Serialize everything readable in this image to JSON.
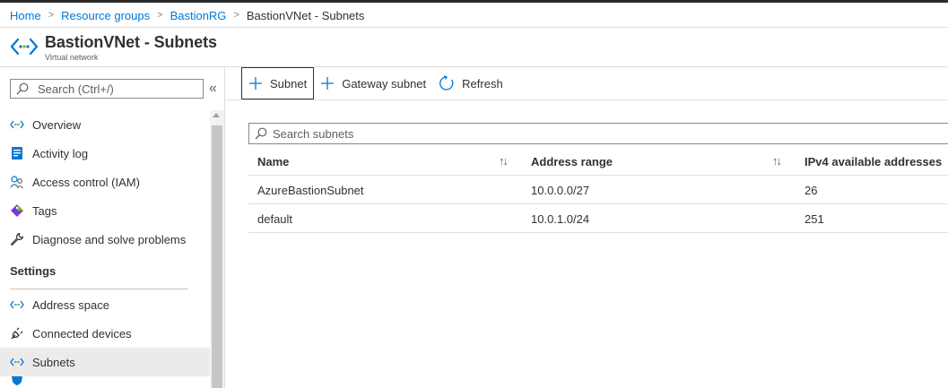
{
  "breadcrumb": {
    "items": [
      "Home",
      "Resource groups",
      "BastionRG"
    ],
    "current": "BastionVNet - Subnets"
  },
  "header": {
    "title": "BastionVNet - Subnets",
    "subtitle": "Virtual network"
  },
  "sidebar": {
    "search_placeholder": "Search (Ctrl+/)",
    "collapse_glyph": "«",
    "items": [
      {
        "label": "Overview",
        "icon": "vnet-icon"
      },
      {
        "label": "Activity log",
        "icon": "activity-log-icon"
      },
      {
        "label": "Access control (IAM)",
        "icon": "people-icon"
      },
      {
        "label": "Tags",
        "icon": "tag-icon"
      },
      {
        "label": "Diagnose and solve problems",
        "icon": "wrench-icon"
      }
    ],
    "section": "Settings",
    "settings_items": [
      {
        "label": "Address space",
        "icon": "vnet-icon"
      },
      {
        "label": "Connected devices",
        "icon": "plug-icon"
      },
      {
        "label": "Subnets",
        "icon": "vnet-icon",
        "active": true
      }
    ]
  },
  "toolbar": {
    "subnet": "Subnet",
    "gateway_subnet": "Gateway subnet",
    "refresh": "Refresh"
  },
  "grid": {
    "search_placeholder": "Search subnets",
    "columns": [
      "Name",
      "Address range",
      "IPv4 available addresses"
    ],
    "sort_glyph": "↑↓",
    "rows": [
      [
        "AzureBastionSubnet",
        "10.0.0.0/27",
        "26"
      ],
      [
        "default",
        "10.0.1.0/24",
        "251"
      ]
    ]
  },
  "colors": {
    "link": "#0078d4",
    "vnet_icon_blue": "#0078d4",
    "vnet_icon_green": "#7fba00",
    "active_bg": "#edebe9"
  }
}
